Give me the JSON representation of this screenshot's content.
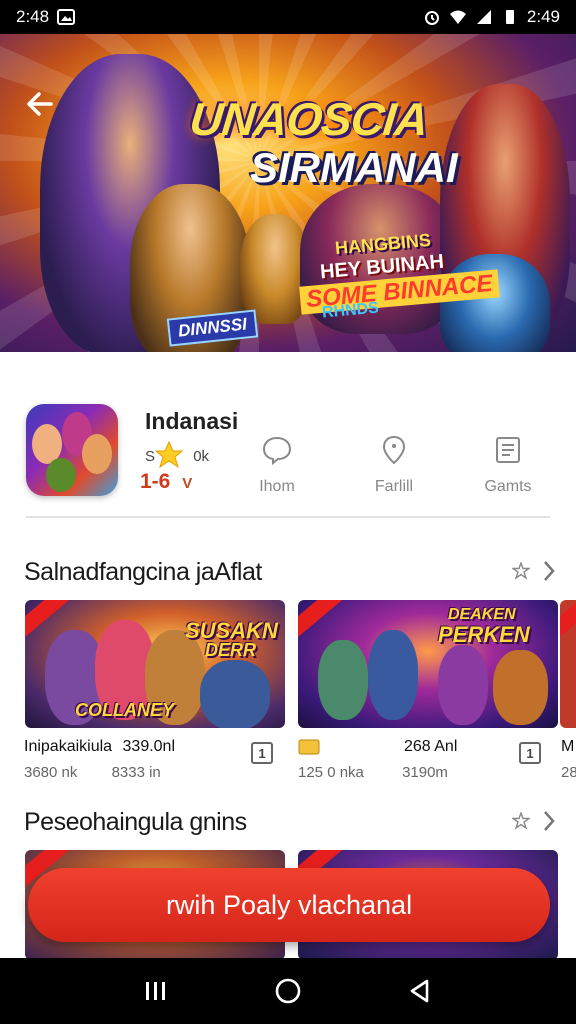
{
  "status_bar": {
    "time_left": "2:48",
    "time_right": "2:49"
  },
  "hero": {
    "title_line1": "UNAOSCIA",
    "title_line2": "SIRMANAI",
    "tag1": "HANGBINS",
    "tag2": "HEY BUINAH",
    "tag3": "SOME BINNACE",
    "tag4": "RHNDS",
    "badge": "DINNSSI"
  },
  "app": {
    "name": "Indanasi",
    "size_text": "S",
    "size_suffix": "0k",
    "rating": "1-6",
    "rating_suffix": "V",
    "meta": [
      {
        "icon": "chat-bubble-icon",
        "label": "Ihom"
      },
      {
        "icon": "location-pin-icon",
        "label": "Farlill"
      },
      {
        "icon": "document-icon",
        "label": "Gamts"
      }
    ]
  },
  "section1": {
    "title": "Salnadfangcina jaAflat",
    "cards": [
      {
        "caption1": "SUSAKN",
        "caption2": "DERR",
        "caption3": "COLLANEY",
        "name": "Inipakaikiula",
        "stat1": "339.0nl",
        "sub1": "3680 nk",
        "sub2": "8333 in",
        "save": "1"
      },
      {
        "caption1": "DEAKEN",
        "caption2": "PERKEN",
        "caption3": "",
        "name": "",
        "stat1": "268 Anl",
        "sub1": "125 0 nka",
        "sub2": "3190m",
        "save": "1"
      }
    ],
    "partial_name": "M",
    "partial_sub": "28"
  },
  "section2": {
    "title": "Peseohaingula gnins"
  },
  "cta": {
    "label": "rwih Poaly vlachanal"
  },
  "colors": {
    "accent": "#e0301e",
    "nav": "#000000"
  }
}
